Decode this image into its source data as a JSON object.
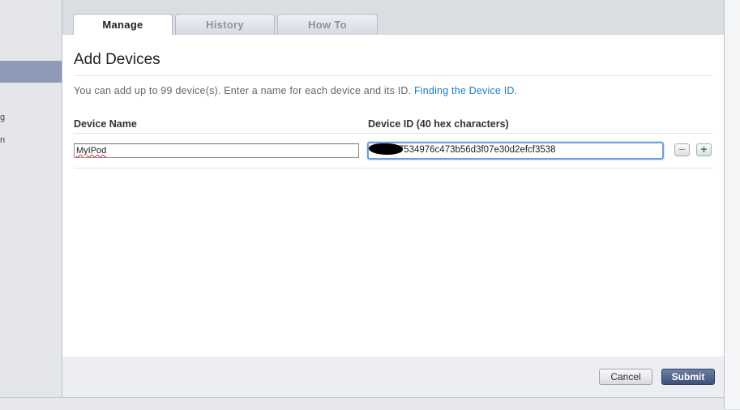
{
  "sidebar": {
    "fragments": [
      "g",
      "n"
    ]
  },
  "tabs": [
    {
      "label": "Manage",
      "active": true
    },
    {
      "label": "History",
      "active": false
    },
    {
      "label": "How To",
      "active": false
    }
  ],
  "main": {
    "title": "Add Devices",
    "intro": "You can add up to 99 device(s). Enter a name for each device and its ID.",
    "intro_link": "Finding the Device ID",
    "intro_end": ".",
    "col_name": "Device Name",
    "col_id": "Device ID (40 hex characters)",
    "row": {
      "name_value": "MyIPod",
      "id_value_visible": "6b7534976c473b56d3f07e30d2efcf3538"
    },
    "remove_symbol": "−",
    "add_symbol": "+"
  },
  "footer": {
    "cancel_label": "Cancel",
    "submit_label": "Submit"
  },
  "colors": {
    "accent_link": "#1a7fbf",
    "submit_bg": "#3f5079",
    "sidebar_selected": "#8f9ab8",
    "focus_ring": "#6f9fd8"
  }
}
